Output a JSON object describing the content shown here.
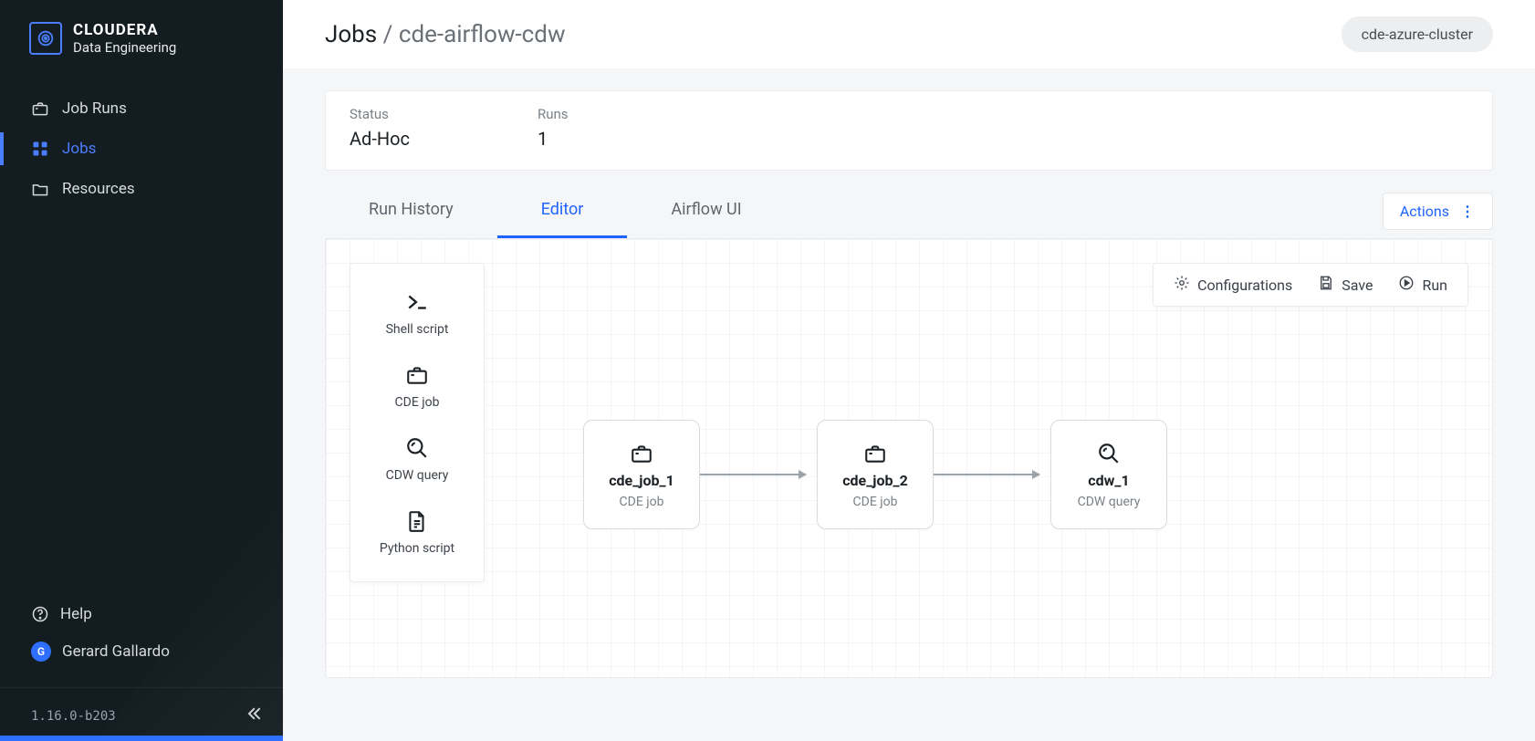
{
  "brand": {
    "line1": "CLOUDERA",
    "line2": "Data Engineering"
  },
  "sidebar": {
    "items": [
      {
        "label": "Job Runs"
      },
      {
        "label": "Jobs"
      },
      {
        "label": "Resources"
      }
    ],
    "help_label": "Help",
    "user_name": "Gerard Gallardo",
    "user_initial": "G",
    "version": "1.16.0-b203"
  },
  "breadcrumb": {
    "root": "Jobs",
    "separator": " / ",
    "current": "cde-airflow-cdw"
  },
  "cluster_pill": "cde-azure-cluster",
  "summary": {
    "status_label": "Status",
    "status_value": "Ad-Hoc",
    "runs_label": "Runs",
    "runs_value": "1"
  },
  "tabs": [
    {
      "label": "Run History"
    },
    {
      "label": "Editor"
    },
    {
      "label": "Airflow UI"
    }
  ],
  "actions_label": "Actions",
  "palette": [
    {
      "id": "shell",
      "label": "Shell script",
      "icon": "terminal"
    },
    {
      "id": "cde",
      "label": "CDE job",
      "icon": "briefcase"
    },
    {
      "id": "cdw",
      "label": "CDW query",
      "icon": "magnify"
    },
    {
      "id": "python",
      "label": "Python script",
      "icon": "file"
    }
  ],
  "toolbar": {
    "configurations": "Configurations",
    "save": "Save",
    "run": "Run"
  },
  "nodes": [
    {
      "id": "cde_job_1",
      "title": "cde_job_1",
      "subtitle": "CDE job",
      "icon": "briefcase"
    },
    {
      "id": "cde_job_2",
      "title": "cde_job_2",
      "subtitle": "CDE job",
      "icon": "briefcase"
    },
    {
      "id": "cdw_1",
      "title": "cdw_1",
      "subtitle": "CDW query",
      "icon": "magnify"
    }
  ]
}
